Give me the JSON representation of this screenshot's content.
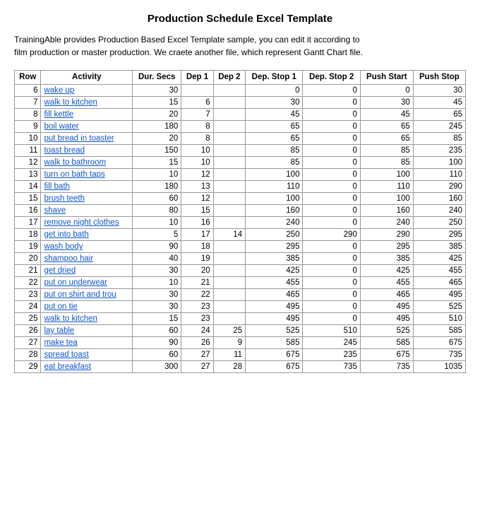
{
  "title": "Production Schedule Excel Template",
  "description": {
    "line1": "TrainingAble provides Production Based Excel Template sample, you can edit it according to",
    "line2": "film production or master production. We craete another file, which represent Gantt Chart file."
  },
  "table": {
    "headers": [
      "Row",
      "Activity",
      "Dur. Secs",
      "Dep 1",
      "Dep 2",
      "Dep. Stop 1",
      "Dep. Stop 2",
      "Push Start",
      "Push Stop"
    ],
    "rows": [
      [
        6,
        "wake up",
        30,
        "",
        "",
        0,
        0,
        0,
        30
      ],
      [
        7,
        "walk to kitchen",
        15,
        6,
        "",
        30,
        0,
        30,
        45
      ],
      [
        8,
        "fill kettle",
        20,
        7,
        "",
        45,
        0,
        45,
        65
      ],
      [
        9,
        "boil water",
        180,
        8,
        "",
        65,
        0,
        65,
        245
      ],
      [
        10,
        "put bread in toaster",
        20,
        8,
        "",
        65,
        0,
        65,
        85
      ],
      [
        11,
        "toast bread",
        150,
        10,
        "",
        85,
        0,
        85,
        235
      ],
      [
        12,
        "walk to bathroom",
        15,
        10,
        "",
        85,
        0,
        85,
        100
      ],
      [
        13,
        "turn on bath taps",
        10,
        12,
        "",
        100,
        0,
        100,
        110
      ],
      [
        14,
        "fill bath",
        180,
        13,
        "",
        110,
        0,
        110,
        290
      ],
      [
        15,
        "brush teeth",
        60,
        12,
        "",
        100,
        0,
        100,
        160
      ],
      [
        16,
        "shave",
        80,
        15,
        "",
        160,
        0,
        160,
        240
      ],
      [
        17,
        "remove night clothes",
        10,
        16,
        "",
        240,
        0,
        240,
        250
      ],
      [
        18,
        "get into bath",
        5,
        17,
        14,
        250,
        290,
        290,
        295
      ],
      [
        19,
        "wash body",
        90,
        18,
        "",
        295,
        0,
        295,
        385
      ],
      [
        20,
        "shampoo hair",
        40,
        19,
        "",
        385,
        0,
        385,
        425
      ],
      [
        21,
        "get dried",
        30,
        20,
        "",
        425,
        0,
        425,
        455
      ],
      [
        22,
        "put on underwear",
        10,
        21,
        "",
        455,
        0,
        455,
        465
      ],
      [
        23,
        "put on shirt and trou",
        30,
        22,
        "",
        465,
        0,
        465,
        495
      ],
      [
        24,
        "put on tie",
        30,
        23,
        "",
        495,
        0,
        495,
        525
      ],
      [
        25,
        "walk to kitchen",
        15,
        23,
        "",
        495,
        0,
        495,
        510
      ],
      [
        26,
        "lay table",
        60,
        24,
        25,
        525,
        510,
        525,
        585
      ],
      [
        27,
        "make tea",
        90,
        26,
        9,
        585,
        245,
        585,
        675
      ],
      [
        28,
        "spread toast",
        60,
        27,
        11,
        675,
        235,
        675,
        735
      ],
      [
        29,
        "eat breakfast",
        300,
        27,
        28,
        675,
        735,
        735,
        1035
      ]
    ]
  }
}
